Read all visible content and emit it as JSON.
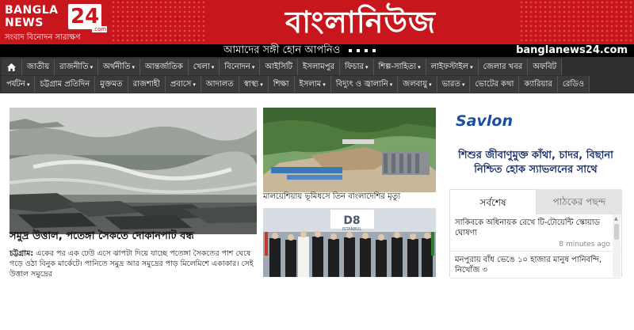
{
  "header": {
    "logo_line1": "BANGLA",
    "logo_line2": "NEWS",
    "logo_number": "24",
    "logo_com": ".com",
    "logo_tagline": "সংবাদ বিনোদন সারাক্ষণ",
    "site_title": "বাংলানিউজ",
    "slogan": "আমাদের সঙ্গী হোন আপনিও",
    "domain": "banglanews24.com",
    "brand_red": "#c8161d"
  },
  "nav": {
    "home_icon": "home-icon",
    "row1": [
      {
        "label": "জাতীয়",
        "dropdown": false
      },
      {
        "label": "রাজনীতি",
        "dropdown": true
      },
      {
        "label": "অর্থনীতি",
        "dropdown": true
      },
      {
        "label": "আন্তর্জাতিক",
        "dropdown": false
      },
      {
        "label": "খেলা",
        "dropdown": true
      },
      {
        "label": "বিনোদন",
        "dropdown": true
      },
      {
        "label": "আইসিটি",
        "dropdown": false
      },
      {
        "label": "ইসলামপুর",
        "dropdown": false
      },
      {
        "label": "ফিচার",
        "dropdown": true
      },
      {
        "label": "শিল্প-সাহিত্য",
        "dropdown": true
      },
      {
        "label": "লাইফস্টাইল",
        "dropdown": true
      },
      {
        "label": "জেলার খবর",
        "dropdown": false
      },
      {
        "label": "অফবিট",
        "dropdown": false
      }
    ],
    "row2": [
      {
        "label": "পর্যটন",
        "dropdown": true
      },
      {
        "label": "চট্টগ্রাম প্রতিদিন",
        "dropdown": false
      },
      {
        "label": "মুক্তমত",
        "dropdown": false
      },
      {
        "label": "রাজশাহী",
        "dropdown": false
      },
      {
        "label": "প্রবাসে",
        "dropdown": true
      },
      {
        "label": "আদালত",
        "dropdown": false
      },
      {
        "label": "স্বাস্থ্য",
        "dropdown": true
      },
      {
        "label": "শিক্ষা",
        "dropdown": false
      },
      {
        "label": "ইসলাম",
        "dropdown": true
      },
      {
        "label": "বিদ্যুৎ ও জ্বালানি",
        "dropdown": true
      },
      {
        "label": "জলবায়ু",
        "dropdown": true
      },
      {
        "label": "ভারত",
        "dropdown": true
      },
      {
        "label": "ভোটের কথা",
        "dropdown": false
      },
      {
        "label": "ক্যারিয়ার",
        "dropdown": false
      },
      {
        "label": "রেডিও",
        "dropdown": false
      }
    ]
  },
  "lead": {
    "title": "সমুদ্র উত্তাল, পতেঙ্গা সৈকতে দোকানপাট বন্ধ",
    "dateline": "চট্টগ্রাম:",
    "excerpt": " একের পর এক ঢেউ এসে ঝাপটা দিয়ে যাচ্ছে পতেঙ্গা সৈকতের পাশ ঘেষে গড়ে ওঠা বিনুক মার্কেটে। পানিতে সমুদ্র আর সমুদ্রের পাড় মিলেমিশে একাকার। সেই উত্তাল সমুদ্রের"
  },
  "story2": {
    "title": "মালয়েশিয়ায় ভূমিধসে তিন বাংলাদেশির মৃত্যু"
  },
  "story3": {
    "banner_text": "D8",
    "banner_city": "ISTANBUL"
  },
  "sidebar": {
    "ad_brand": "Savlon",
    "ad_text": "শিশুর জীবাণুমুক্ত কাঁথা, চাদর, বিছানা নিশ্চিত হোক স্যাভলনের সাথে",
    "tab_latest": "সর্বশেষ",
    "tab_popular": "পাঠকের পছন্দ",
    "latest": [
      {
        "title": "সাকিবকে অধিনায়ক রেখে টি-টোয়েন্টি স্কোয়াড ঘোষণা",
        "time": "8 minutes ago"
      },
      {
        "title": "মনপুরায় বাঁধ ভেঙে ১০ হাজার মানুষ পানিবন্দি, নিখোঁজ ৩",
        "time": ""
      }
    ]
  }
}
